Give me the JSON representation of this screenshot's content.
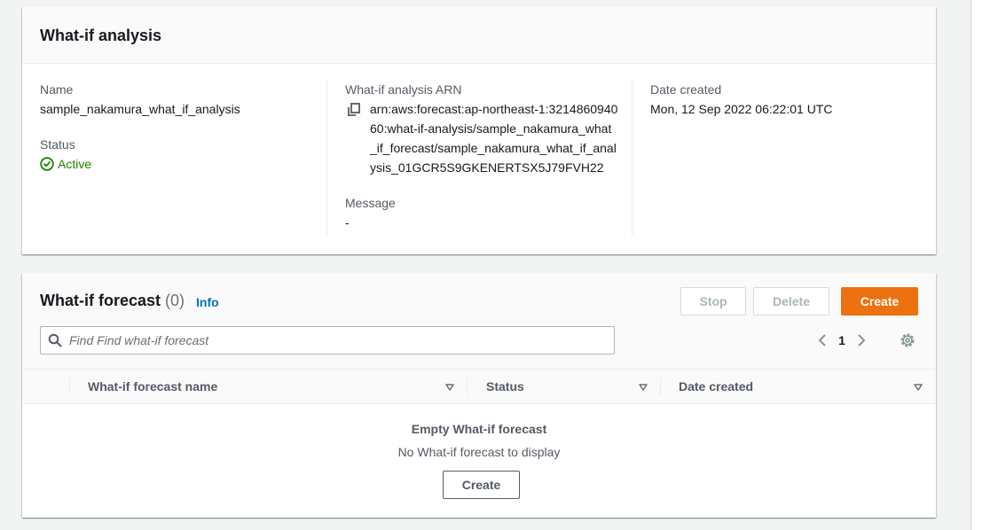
{
  "analysis": {
    "title": "What-if analysis",
    "name_label": "Name",
    "name_value": "sample_nakamura_what_if_analysis",
    "status_label": "Status",
    "status_value": "Active",
    "arn_label": "What-if analysis ARN",
    "arn_value": "arn:aws:forecast:ap-northeast-1:321486094060:what-if-analysis/sample_nakamura_what_if_forecast/sample_nakamura_what_if_analysis_01GCR5S9GKENERTSX5J79FVH22",
    "message_label": "Message",
    "message_value": "-",
    "date_label": "Date created",
    "date_value": "Mon, 12 Sep 2022 06:22:01 UTC"
  },
  "forecast": {
    "title": "What-if forecast",
    "count": "(0)",
    "info": "Info",
    "stop_label": "Stop",
    "delete_label": "Delete",
    "create_label": "Create",
    "search_placeholder": "Find Find what-if forecast",
    "page": "1",
    "columns": [
      "What-if forecast name",
      "Status",
      "Date created"
    ],
    "empty_title": "Empty What-if forecast",
    "empty_message": "No What-if forecast to display",
    "empty_create_label": "Create"
  },
  "colors": {
    "accent": "#ec7211",
    "link": "#0073bb",
    "success": "#1d8102"
  },
  "icons": [
    "copy-icon",
    "check-circle-icon",
    "search-icon",
    "chevron-left-icon",
    "chevron-right-icon",
    "gear-icon",
    "sort-icon"
  ]
}
